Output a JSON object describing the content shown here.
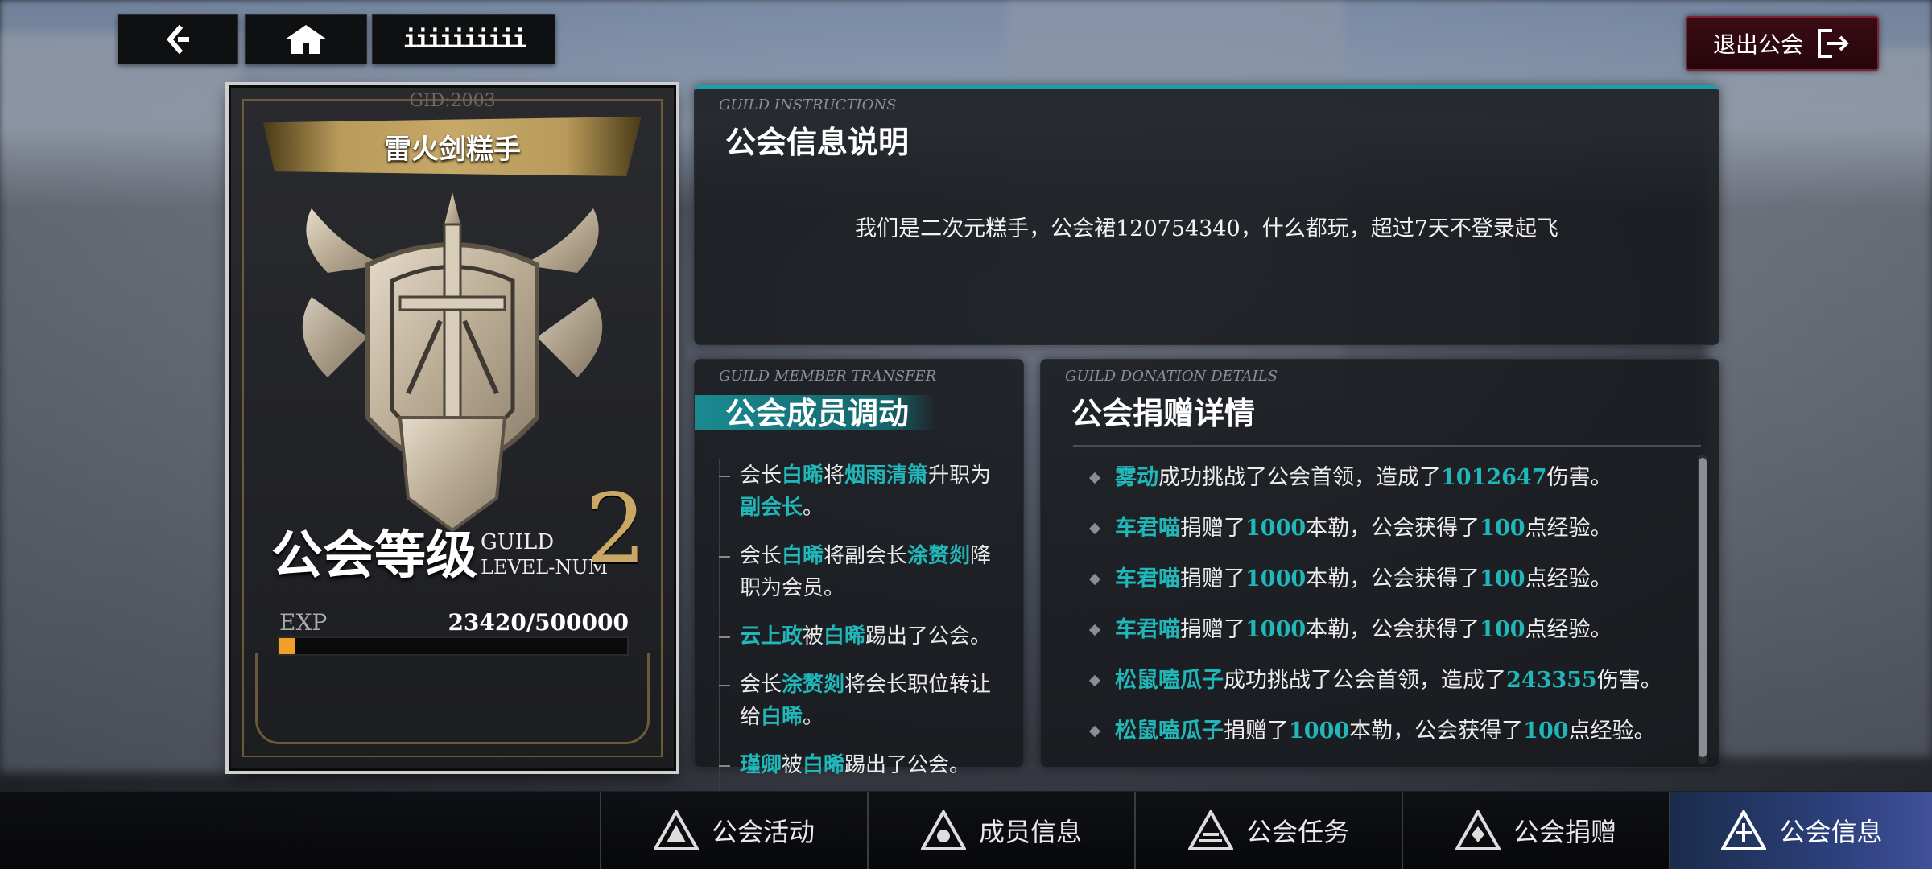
{
  "top_nav": {
    "back_icon": "back-arrow-icon",
    "home_icon": "home-icon",
    "menu_label": "iiiiiiiiii"
  },
  "exit_button": {
    "label": "退出公会",
    "icon": "exit-door-icon"
  },
  "guild_card": {
    "gid": "GID:2003",
    "name": "雷火剑糕手",
    "level_label_cn": "公会等级",
    "level_label_en_1": "GUILD",
    "level_label_en_2": "LEVEL-NUM",
    "level_num": "2",
    "exp_label": "EXP",
    "exp_value": "23420/500000",
    "exp_fraction": 0.0468
  },
  "instructions": {
    "en": "GUILD INSTRUCTIONS",
    "title": "公会信息说明",
    "text": "我们是二次元糕手，公会裙120754340，什么都玩，超过7天不登录起飞"
  },
  "transfer": {
    "en": "GUILD MEMBER TRANSFER",
    "title": "公会成员调动",
    "items": [
      [
        {
          "t": "会长"
        },
        {
          "t": "白晞",
          "h": true
        },
        {
          "t": "将"
        },
        {
          "t": "烟雨清箫",
          "h": true
        },
        {
          "t": "升职为"
        },
        {
          "t": "副会长",
          "h": true
        },
        {
          "t": "。"
        }
      ],
      [
        {
          "t": "会长"
        },
        {
          "t": "白晞",
          "h": true
        },
        {
          "t": "将副会长"
        },
        {
          "t": "涂赘剡",
          "h": true
        },
        {
          "t": "降职为会员。"
        }
      ],
      [
        {
          "t": "云上政",
          "h": true
        },
        {
          "t": "被"
        },
        {
          "t": "白晞",
          "h": true
        },
        {
          "t": "踢出了公会。"
        }
      ],
      [
        {
          "t": "会长"
        },
        {
          "t": "涂赘剡",
          "h": true
        },
        {
          "t": "将会长职位转让给"
        },
        {
          "t": "白晞",
          "h": true
        },
        {
          "t": "。"
        }
      ],
      [
        {
          "t": "瑾卿",
          "h": true
        },
        {
          "t": "被"
        },
        {
          "t": "白晞",
          "h": true
        },
        {
          "t": "踢出了公会。"
        }
      ]
    ]
  },
  "donation": {
    "en": "GUILD DONATION DETAILS",
    "title": "公会捐赠详情",
    "items": [
      [
        {
          "t": "雾动",
          "h": true
        },
        {
          "t": "成功挑战了公会首领，造成了"
        },
        {
          "t": "1012647",
          "h": true
        },
        {
          "t": "伤害。"
        }
      ],
      [
        {
          "t": "车君喵",
          "h": true
        },
        {
          "t": "捐赠了"
        },
        {
          "t": "1000",
          "h": true
        },
        {
          "t": "本勒，公会获得了"
        },
        {
          "t": "100",
          "h": true
        },
        {
          "t": "点经验。"
        }
      ],
      [
        {
          "t": "车君喵",
          "h": true
        },
        {
          "t": "捐赠了"
        },
        {
          "t": "1000",
          "h": true
        },
        {
          "t": "本勒，公会获得了"
        },
        {
          "t": "100",
          "h": true
        },
        {
          "t": "点经验。"
        }
      ],
      [
        {
          "t": "车君喵",
          "h": true
        },
        {
          "t": "捐赠了"
        },
        {
          "t": "1000",
          "h": true
        },
        {
          "t": "本勒，公会获得了"
        },
        {
          "t": "100",
          "h": true
        },
        {
          "t": "点经验。"
        }
      ],
      [
        {
          "t": "松鼠嗑瓜子",
          "h": true
        },
        {
          "t": "成功挑战了公会首领，造成了"
        },
        {
          "t": "243355",
          "h": true
        },
        {
          "t": "伤害。"
        }
      ],
      [
        {
          "t": "松鼠嗑瓜子",
          "h": true
        },
        {
          "t": "捐赠了"
        },
        {
          "t": "1000",
          "h": true
        },
        {
          "t": "本勒，公会获得了"
        },
        {
          "t": "100",
          "h": true
        },
        {
          "t": "点经验。"
        }
      ]
    ]
  },
  "bottom_nav": {
    "tabs": [
      {
        "label": "公会活动",
        "icon": "guild-activity-icon",
        "active": false
      },
      {
        "label": "成员信息",
        "icon": "member-info-icon",
        "active": false
      },
      {
        "label": "公会任务",
        "icon": "guild-task-icon",
        "active": false
      },
      {
        "label": "公会捐赠",
        "icon": "guild-donation-icon",
        "active": false
      },
      {
        "label": "公会信息",
        "icon": "guild-info-icon",
        "active": true
      }
    ]
  },
  "colors": {
    "highlight": "#21b6b8",
    "accent": "#1aa0a8",
    "exp_fill": "#f0a028",
    "exit_red": "#3a0c14"
  }
}
